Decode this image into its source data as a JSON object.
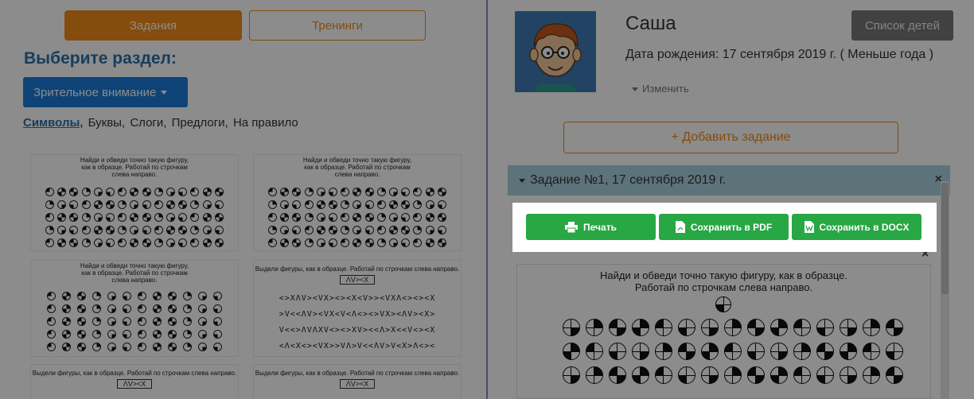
{
  "left": {
    "tabs": [
      {
        "label": "Задания",
        "active": true
      },
      {
        "label": "Тренинги",
        "active": false
      }
    ],
    "section_title": "Выберите раздел:",
    "dropdown_label": "Зрительное внимание",
    "categories": [
      {
        "label": "Символы,",
        "active": true
      },
      {
        "label": "Буквы,",
        "active": false
      },
      {
        "label": "Слоги,",
        "active": false
      },
      {
        "label": "Предлоги,",
        "active": false
      },
      {
        "label": "На правило",
        "active": false
      }
    ],
    "thumbnails": [
      {
        "caption": "Найди и обведи точно такую фигуру, как в образце. Работай по строчкам слева направо."
      },
      {
        "caption": "Найди и обведи точно такую фигуру, как в образце. Работай по строчкам слева направо."
      },
      {
        "caption": "Найди и обведи точно такую фигуру, как в образце. Работай по строчкам слева направо."
      },
      {
        "caption": "Выдели фигуры, как в образце. Работай по строчкам слева направо.",
        "sample": "ΛV><X",
        "lines": [
          "<>XΛV><VX><><X<V>><VXΛ<><><X",
          ">V<<ΛV><VX<V<Λ<><>VX><ΛV><X>",
          "V<<>ΛVΛXV<><>XV><<Λ>X<<V<><X",
          "<Λ<X<><VX>>VΛ>V<<ΛV>V<X>Λ<><"
        ]
      },
      {
        "caption": "Выдели фигуры, как в образце. Работай по строчкам слева направо.",
        "sample": "ΛV><X"
      },
      {
        "caption": "Выдели фигуры, как в образце. Работай по строчкам слева направо.",
        "sample": "ΛV><X"
      }
    ]
  },
  "right": {
    "child_name": "Саша",
    "birth_date": "Дата рождения: 17 сентября 2019 г. ( Меньше года )",
    "edit_label": "Изменить",
    "children_list_label": "Список детей",
    "add_task_label": "+ Добавить задание",
    "task_title": "Задание №1, 17 сентября 2019 г.",
    "close_symbol": "×",
    "export": {
      "print_label": "Печать",
      "pdf_label": "Сохранить в PDF",
      "docx_label": "Сохранить в DOCX"
    },
    "worksheet": {
      "caption_line1": "Найди и обведи точно такую фигуру, как в образце.",
      "caption_line2": "Работай по строчкам слева направо."
    }
  },
  "colors": {
    "orange": "#f08a18",
    "blue": "#1a7ad9",
    "title_blue": "#2c6fa6",
    "green": "#28a745",
    "task_header": "#a9d1de",
    "divider": "#8a8ab4",
    "gray_button": "#777777"
  },
  "icons": {
    "print": "printer-icon",
    "pdf": "pdf-file-icon",
    "docx": "docx-file-icon",
    "dropdown": "caret-down-icon",
    "close": "close-icon"
  }
}
